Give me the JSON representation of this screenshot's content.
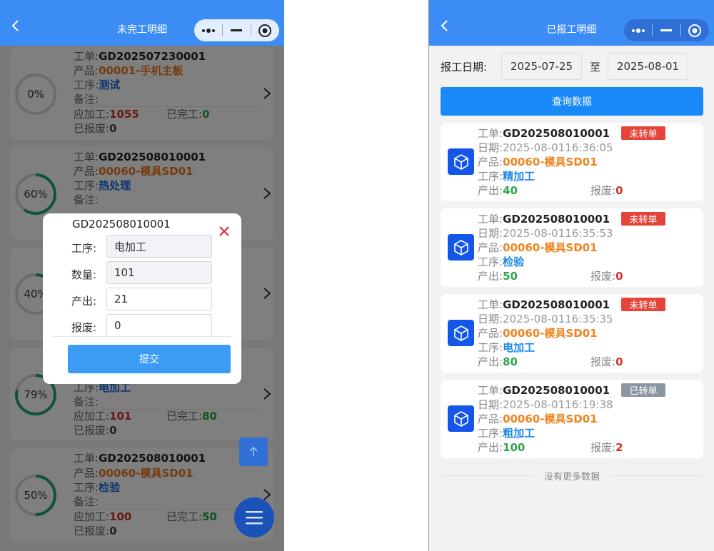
{
  "left": {
    "nav_title": "未完工明细",
    "cards": [
      {
        "pct_text": "0%",
        "progress": 0,
        "order_label": "工单:",
        "order": "GD202507230001",
        "product_label": "产品:",
        "product": "00001-手机主板",
        "process_label": "工序:",
        "process": "测试",
        "note_label": "备注:",
        "plan_label": "应加工:",
        "plan": "1055",
        "done_label": "已完工:",
        "done": "0",
        "scrap_label": "已报废:",
        "scrap": "0"
      },
      {
        "pct_text": "60%",
        "progress": 0.6,
        "order_label": "工单:",
        "order": "GD202508010001",
        "product_label": "产品:",
        "product": "00060-模具SD01",
        "process_label": "工序:",
        "process": "热处理",
        "note_label": "备注:"
      },
      {
        "pct_text": "40%",
        "progress": 0.4
      },
      {
        "pct_text": "79%",
        "progress": 0.79,
        "process_label": "工序:",
        "process": "电加工",
        "note_label": "备注:",
        "plan_label": "应加工:",
        "plan": "101",
        "done_label": "已完工:",
        "done": "80",
        "scrap_label": "已报废:",
        "scrap": "0"
      },
      {
        "pct_text": "50%",
        "progress": 0.5,
        "order_label": "工单:",
        "order": "GD202508010001",
        "product_label": "产品:",
        "product": "00060-模具SD01",
        "process_label": "工序:",
        "process": "检验",
        "note_label": "备注:",
        "plan_label": "应加工:",
        "plan": "100",
        "done_label": "已完工:",
        "done": "50",
        "scrap_label": "已报废:",
        "scrap": "0"
      }
    ],
    "dialog": {
      "title": "GD202508010001",
      "process_label": "工序:",
      "process_value": "电加工",
      "qty_label": "数量:",
      "qty_value": "101",
      "output_label": "产出:",
      "output_value": "21",
      "scrap_label": "报废:",
      "scrap_value": "0",
      "submit": "提交"
    }
  },
  "right": {
    "nav_title": "已报工明细",
    "date_label": "报工日期:",
    "date_from": "2025-07-25",
    "to_label": "至",
    "date_to": "2025-08-01",
    "query_button": "查询数据",
    "records": [
      {
        "order_label": "工单:",
        "order": "GD202508010001",
        "tag": "未转单",
        "tag_color": "#e5443a",
        "date_label": "日期:",
        "date": "2025-08-0116:36:05",
        "product_label": "产品:",
        "product": "00060-模具SD01",
        "process_label": "工序:",
        "process": "精加工",
        "output_label": "产出:",
        "output": "40",
        "scrap_label": "报废:",
        "scrap": "0"
      },
      {
        "order_label": "工单:",
        "order": "GD202508010001",
        "tag": "未转单",
        "tag_color": "#e5443a",
        "date_label": "日期:",
        "date": "2025-08-0116:35:53",
        "product_label": "产品:",
        "product": "00060-模具SD01",
        "process_label": "工序:",
        "process": "检验",
        "output_label": "产出:",
        "output": "50",
        "scrap_label": "报废:",
        "scrap": "0"
      },
      {
        "order_label": "工单:",
        "order": "GD202508010001",
        "tag": "未转单",
        "tag_color": "#e5443a",
        "date_label": "日期:",
        "date": "2025-08-0116:35:35",
        "product_label": "产品:",
        "product": "00060-模具SD01",
        "process_label": "工序:",
        "process": "电加工",
        "output_label": "产出:",
        "output": "80",
        "scrap_label": "报废:",
        "scrap": "0"
      },
      {
        "order_label": "工单:",
        "order": "GD202508010001",
        "tag": "已转单",
        "tag_color": "#8a97a3",
        "date_label": "日期:",
        "date": "2025-08-0116:19:38",
        "product_label": "产品:",
        "product": "00060-模具SD01",
        "process_label": "工序:",
        "process": "粗加工",
        "output_label": "产出:",
        "output": "100",
        "scrap_label": "报废:",
        "scrap": "2"
      }
    ],
    "no_more": "没有更多数据"
  },
  "colors": {
    "primary": "#3c8cf5",
    "progress_ring": "#1aa67a",
    "ring_track": "#d8d8d8",
    "danger": "#e5443a"
  }
}
